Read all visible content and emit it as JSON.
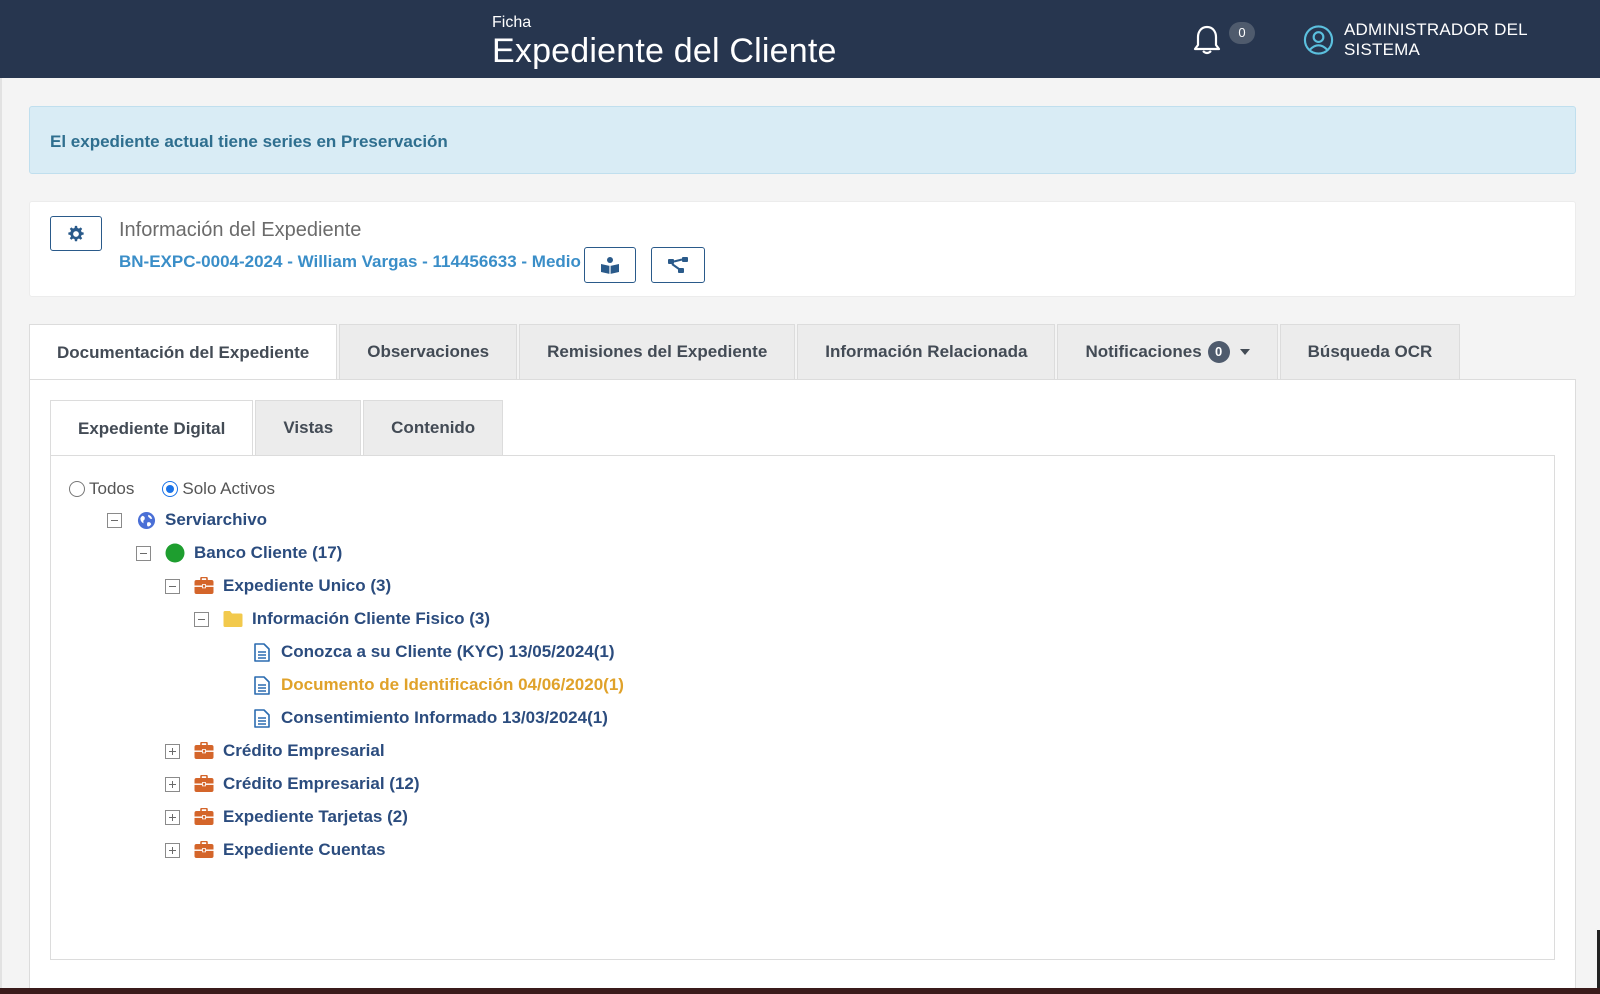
{
  "header": {
    "subtitle": "Ficha",
    "title": "Expediente del Cliente",
    "notifications_count": "0",
    "user_name": "ADMINISTRADOR DEL SISTEMA"
  },
  "alert": {
    "message": "El expediente actual tiene series en Preservación"
  },
  "info": {
    "heading": "Información del Expediente",
    "expediente_link": "BN-EXPC-0004-2024 - William Vargas - 114456633 - Medio"
  },
  "tabs": [
    {
      "label": "Documentación del Expediente",
      "active": true
    },
    {
      "label": "Observaciones"
    },
    {
      "label": "Remisiones del Expediente"
    },
    {
      "label": "Información Relacionada"
    },
    {
      "label": "Notificaciones",
      "badge": "0"
    },
    {
      "label": "Búsqueda OCR"
    }
  ],
  "subtabs": [
    {
      "label": "Expediente Digital",
      "active": true
    },
    {
      "label": "Vistas"
    },
    {
      "label": "Contenido"
    }
  ],
  "filter": {
    "options": [
      {
        "label": "Todos",
        "checked": false
      },
      {
        "label": "Solo Activos",
        "checked": true
      }
    ]
  },
  "tree": [
    {
      "label": "Serviarchivo",
      "icon": "globe-icon",
      "toggle": "minus"
    },
    {
      "label": "Banco Cliente (17)",
      "icon": "green-dot-icon",
      "toggle": "minus"
    },
    {
      "label": "Expediente Unico (3)",
      "icon": "briefcase-icon",
      "toggle": "minus"
    },
    {
      "label": "Información Cliente Fisico (3)",
      "icon": "folder-icon",
      "toggle": "minus"
    },
    {
      "label": "Conozca a su Cliente (KYC) 13/05/2024(1)",
      "icon": "document-icon"
    },
    {
      "label": "Documento de Identificación 04/06/2020(1)",
      "icon": "document-icon",
      "status": "warning"
    },
    {
      "label": "Consentimiento Informado 13/03/2024(1)",
      "icon": "document-icon"
    },
    {
      "label": "Crédito Empresarial",
      "icon": "briefcase-icon",
      "toggle": "plus"
    },
    {
      "label": "Crédito Empresarial (12)",
      "icon": "briefcase-icon",
      "toggle": "plus"
    },
    {
      "label": "Expediente Tarjetas (2)",
      "icon": "briefcase-icon",
      "toggle": "plus"
    },
    {
      "label": "Expediente Cuentas",
      "icon": "briefcase-icon",
      "toggle": "plus"
    }
  ],
  "colors": {
    "header_bg": "#27364f",
    "link": "#3a8ec8",
    "tree_text": "#2b4c7e",
    "warning_text": "#e0a22a",
    "briefcase": "#d4652a",
    "folder": "#f2c94c",
    "green_dot": "#1e9e2f",
    "alert_bg": "#d9ecf5"
  }
}
